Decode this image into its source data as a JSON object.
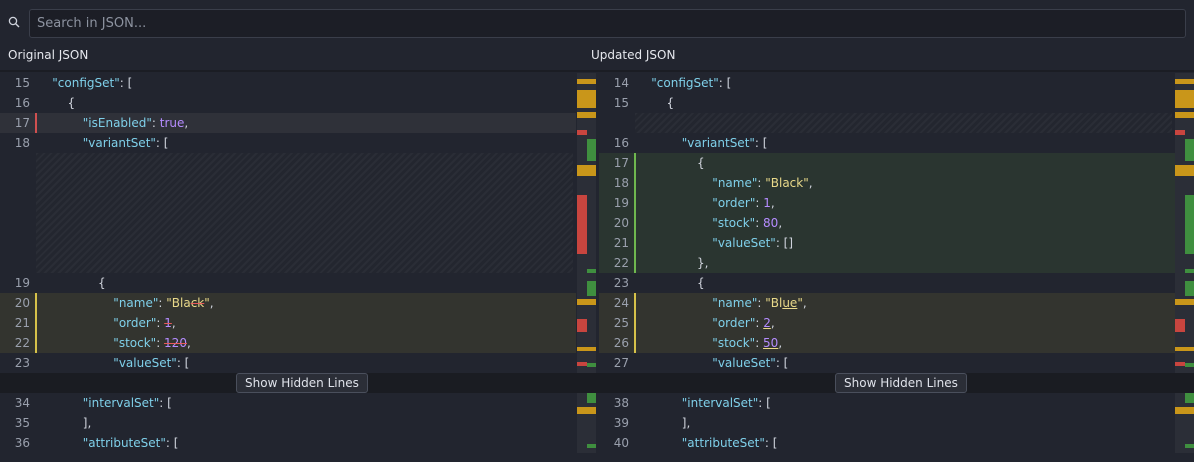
{
  "search": {
    "placeholder": "Search in JSON..."
  },
  "panes": {
    "left": {
      "title": "Original JSON"
    },
    "right": {
      "title": "Updated JSON"
    }
  },
  "fold": {
    "button_label": "Show Hidden Lines"
  },
  "colors": {
    "key": "#7fd0ea",
    "string": "#e9d98a",
    "number": "#b58cff",
    "removed": "#c8453f",
    "added": "#3f8f3f",
    "changed": "#c9961a"
  },
  "left_lines": [
    {
      "num": "15",
      "indent": "    ",
      "key": "configSet",
      "rest": ": ["
    },
    {
      "num": "16",
      "indent": "        ",
      "punct": "{"
    },
    {
      "num": "17",
      "indent": "            ",
      "key": "isEnabled",
      "sep": ": ",
      "bool": "true",
      "tail": ","
    },
    {
      "num": "18",
      "indent": "            ",
      "key": "variantSet",
      "rest": ": ["
    },
    {
      "num": "19",
      "indent": "                ",
      "punct": "{"
    },
    {
      "num": "20",
      "indent": "                    ",
      "key": "name",
      "sep": ": ",
      "str_pre": "\"Bla",
      "str_del": "ck",
      "str_post": "\"",
      "tail": ","
    },
    {
      "num": "21",
      "indent": "                    ",
      "key": "order",
      "sep": ": ",
      "num_del": "1",
      "tail": ","
    },
    {
      "num": "22",
      "indent": "                    ",
      "key": "stock",
      "sep": ": ",
      "num_del": "120",
      "tail": ","
    },
    {
      "num": "23",
      "indent": "                    ",
      "key": "valueSet",
      "rest": ": ["
    },
    {
      "num": "34",
      "indent": "            ",
      "key": "intervalSet",
      "rest": ": ["
    },
    {
      "num": "35",
      "indent": "            ",
      "punct": "],"
    },
    {
      "num": "36",
      "indent": "            ",
      "key": "attributeSet",
      "rest": ": ["
    }
  ],
  "right_lines": [
    {
      "num": "14",
      "indent": "    ",
      "key": "configSet",
      "rest": ": ["
    },
    {
      "num": "15",
      "indent": "        ",
      "punct": "{"
    },
    {
      "num": "16",
      "indent": "            ",
      "key": "variantSet",
      "rest": ": ["
    },
    {
      "num": "17",
      "indent": "                ",
      "punct": "{"
    },
    {
      "num": "18",
      "indent": "                    ",
      "key": "name",
      "sep": ": ",
      "str": "\"Black\"",
      "tail": ","
    },
    {
      "num": "19",
      "indent": "                    ",
      "key": "order",
      "sep": ": ",
      "numv": "1",
      "tail": ","
    },
    {
      "num": "20",
      "indent": "                    ",
      "key": "stock",
      "sep": ": ",
      "numv": "80",
      "tail": ","
    },
    {
      "num": "21",
      "indent": "                    ",
      "key": "valueSet",
      "rest": ": []"
    },
    {
      "num": "22",
      "indent": "                ",
      "punct": "},"
    },
    {
      "num": "23",
      "indent": "                ",
      "punct": "{"
    },
    {
      "num": "24",
      "indent": "                    ",
      "key": "name",
      "sep": ": ",
      "str_pre": "\"Bl",
      "str_ins": "ue",
      "str_post": "\"",
      "tail": ","
    },
    {
      "num": "25",
      "indent": "                    ",
      "key": "order",
      "sep": ": ",
      "num_ins": "2",
      "tail": ","
    },
    {
      "num": "26",
      "indent": "                    ",
      "key": "stock",
      "sep": ": ",
      "num_ins": "50",
      "tail": ","
    },
    {
      "num": "27",
      "indent": "                    ",
      "key": "valueSet",
      "rest": ": ["
    },
    {
      "num": "38",
      "indent": "            ",
      "key": "intervalSet",
      "rest": ": ["
    },
    {
      "num": "39",
      "indent": "            ",
      "punct": "],"
    },
    {
      "num": "40",
      "indent": "            ",
      "key": "attributeSet",
      "rest": ": ["
    }
  ]
}
